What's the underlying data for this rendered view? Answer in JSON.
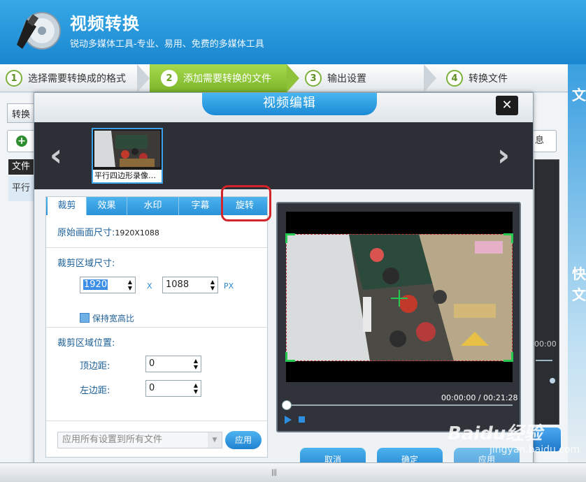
{
  "app": {
    "title": "视频转换",
    "subtitle": "锐动多媒体工具-专业、易用、免费的多媒体工具"
  },
  "steps": [
    {
      "num": "1",
      "label": "选择需要转换成的格式"
    },
    {
      "num": "2",
      "label": "添加需要转换的文件",
      "active": true
    },
    {
      "num": "3",
      "label": "输出设置"
    },
    {
      "num": "4",
      "label": "转换文件"
    }
  ],
  "background": {
    "tab_label": "转换",
    "list_header": "文件",
    "list_row": "平行",
    "right_tab": "息",
    "right_time": "00:00",
    "side_text_1": "文",
    "side_text_2": "快",
    "side_text_3": "文"
  },
  "dialog": {
    "title": "视频编辑",
    "close": "✕",
    "thumbnail_label": "平行四边形录像…",
    "tabs": [
      "裁剪",
      "效果",
      "水印",
      "字幕",
      "旋转"
    ],
    "original_size_label": "原始画面尺寸:",
    "original_size_value": "1920X1088",
    "crop_size_label": "裁剪区域尺寸:",
    "crop_width": "1920",
    "crop_height": "1088",
    "times_sign": "X",
    "unit_px": "PX",
    "keep_ratio_label": "保持宽高比",
    "crop_pos_label": "裁剪区域位置:",
    "top_margin_label": "顶边距:",
    "top_margin_value": "0",
    "left_margin_label": "左边距:",
    "left_margin_value": "0",
    "apply_select_placeholder": "应用所有设置到所有文件",
    "apply_button": "应用",
    "time_current": "00:00:00",
    "time_sep": "/",
    "time_total": "00:21:28",
    "buttons": {
      "cancel": "取消",
      "ok": "确定",
      "apply": "应用"
    }
  },
  "watermark": {
    "brand": "Baidu经验",
    "url": "jingyan.baidu.com"
  },
  "colors": {
    "accent": "#2a92d8",
    "active_step": "#7bb62a",
    "highlight": "#d3232b"
  }
}
